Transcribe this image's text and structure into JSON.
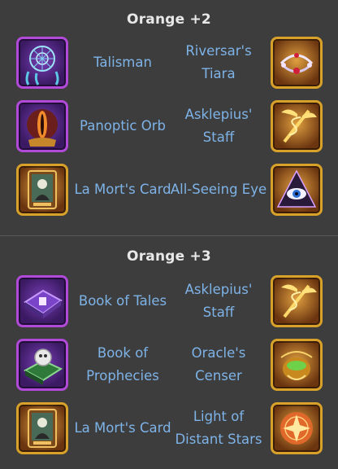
{
  "sections": [
    {
      "title": "Orange +2",
      "rows": [
        {
          "left": {
            "name": "Talisman",
            "icon": "dreamcatcher-talisman-icon"
          },
          "right": {
            "name": "Riversar's Tiara",
            "icon": "tiara-icon"
          }
        },
        {
          "left": {
            "name": "Panoptic Orb",
            "icon": "panoptic-orb-icon"
          },
          "right": {
            "name": "Asklepius' Staff",
            "icon": "asklepius-staff-icon"
          }
        },
        {
          "left": {
            "name": "La Mort's Card",
            "icon": "la-mort-card-icon"
          },
          "right": {
            "name": "All-Seeing Eye",
            "icon": "all-seeing-eye-icon"
          }
        }
      ]
    },
    {
      "title": "Orange +3",
      "rows": [
        {
          "left": {
            "name": "Book of Tales",
            "icon": "book-of-tales-icon"
          },
          "right": {
            "name": "Asklepius' Staff",
            "icon": "asklepius-staff-icon"
          }
        },
        {
          "left": {
            "name": "Book of Prophecies",
            "icon": "book-of-prophecies-icon"
          },
          "right": {
            "name": "Oracle's Censer",
            "icon": "oracle-censer-icon"
          }
        },
        {
          "left": {
            "name": "La Mort's Card",
            "icon": "la-mort-card-icon"
          },
          "right": {
            "name": "Light of Distant Stars",
            "icon": "light-of-distant-stars-icon"
          }
        }
      ]
    }
  ],
  "colors": {
    "background": "#3d3d3d",
    "title": "#e8e8e8",
    "item_label": "#7eb3e8",
    "purple_frame": "#b14ad8",
    "gold_frame": "#d7a12a"
  }
}
